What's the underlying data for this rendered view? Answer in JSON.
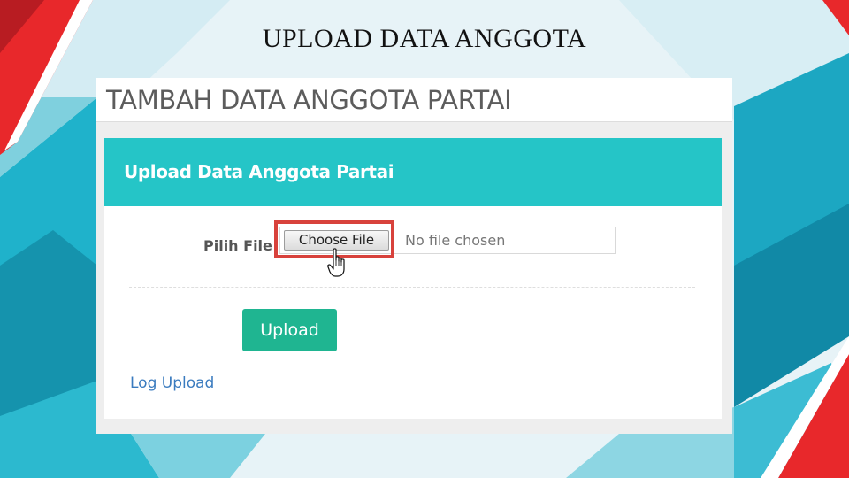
{
  "slide": {
    "title": "UPLOAD DATA ANGGOTA"
  },
  "page": {
    "header_title": "TAMBAH DATA ANGGOTA PARTAI"
  },
  "panel": {
    "heading": "Upload Data Anggota Partai"
  },
  "form": {
    "file_label": "Pilih File",
    "choose_file_label": "Choose File",
    "no_file_text": "No file chosen",
    "upload_label": "Upload",
    "log_upload_label": "Log Upload"
  },
  "colors": {
    "panel_heading": "#25c5c7",
    "upload_button": "#1fb591",
    "highlight": "#d8423c",
    "link": "#3a7bbf",
    "decor_red": "#e8282b",
    "decor_teal": "#1aa9c2"
  },
  "icons": {
    "cursor": "hand-pointer-cursor-icon"
  }
}
